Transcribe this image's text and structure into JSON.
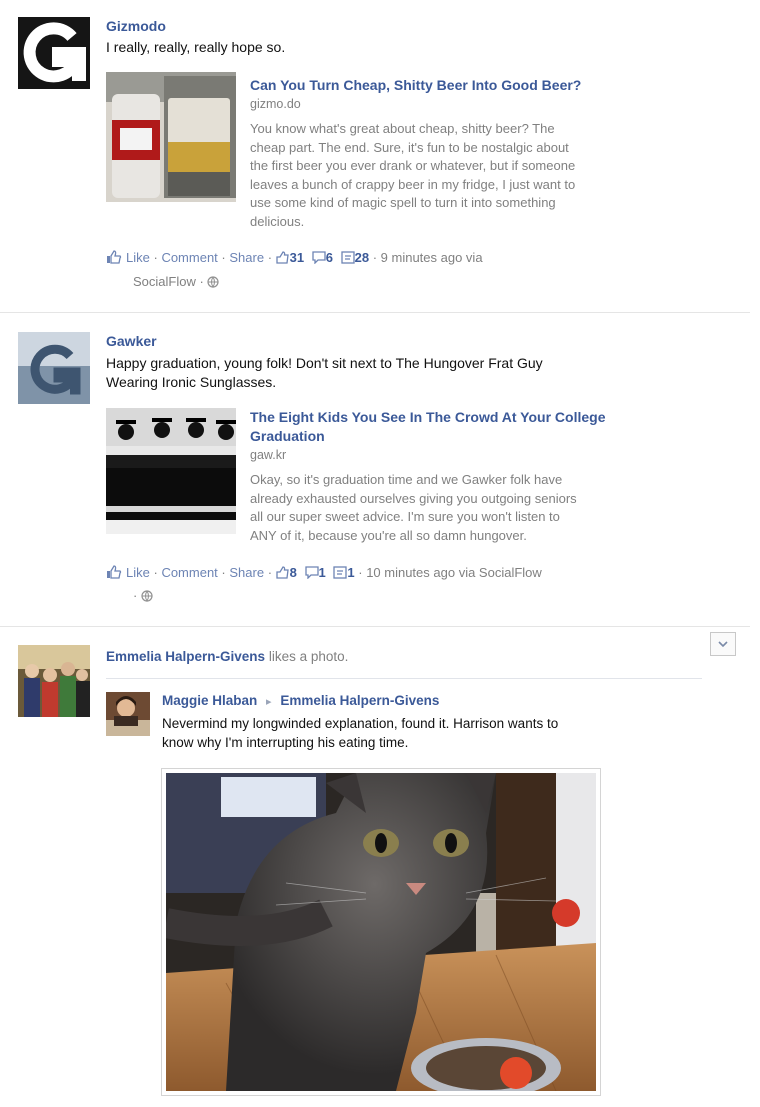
{
  "posts": [
    {
      "author": "Gizmodo",
      "message": "I really, really, really hope so.",
      "link": {
        "title": "Can You Turn Cheap, Shitty Beer Into Good Beer?",
        "domain": "gizmo.do",
        "summary_lines": [
          "You know what's great about cheap, shitty beer? The",
          "cheap part. The end. Sure, it's fun to be nostalgic about",
          "the first beer you ever drank or whatever, but if someone",
          "leaves a bunch of crappy beer in my fridge, I just want to",
          "use some kind of magic spell to turn it into something",
          "delicious."
        ]
      },
      "actions": {
        "like": "Like",
        "comment": "Comment",
        "share": "Share",
        "likes_count": "31",
        "comments_count": "6",
        "shares_count": "28",
        "time": "9 minutes ago via",
        "via": "SocialFlow"
      }
    },
    {
      "author": "Gawker",
      "message_lines": [
        "Happy graduation, young folk! Don't sit next to The Hungover Frat Guy",
        "Wearing Ironic Sunglasses."
      ],
      "link": {
        "title_lines": [
          "The Eight Kids You See In The Crowd At Your College",
          "Graduation"
        ],
        "domain": "gaw.kr",
        "summary_lines": [
          "Okay, so it's graduation time and we Gawker folk have",
          "already exhausted ourselves giving you outgoing seniors",
          "all our super sweet advice. I'm sure you won't listen to",
          "ANY of it, because you're all so damn hungover."
        ]
      },
      "actions": {
        "like": "Like",
        "comment": "Comment",
        "share": "Share",
        "likes_count": "8",
        "comments_count": "1",
        "shares_count": "1",
        "time": "10 minutes ago via SocialFlow"
      }
    },
    {
      "author": "Emmelia Halpern-Givens",
      "activity": "likes a photo.",
      "shared": {
        "author": "Maggie Hlaban",
        "arrow": "▸",
        "target": "Emmelia Halpern-Givens",
        "message_lines": [
          "Nevermind my longwinded explanation, found it. Harrison wants to",
          "know why I'm interrupting his eating time."
        ]
      }
    }
  ],
  "icons": {
    "like": "thumbs-up-icon",
    "comment": "comment-bubble-icon",
    "share": "share-icon",
    "globe": "globe-icon",
    "menu": "chevron-down-icon"
  },
  "colors": {
    "link_blue": "#3b5998",
    "muted_gray": "#808080",
    "action_blue": "#6d84b4"
  }
}
